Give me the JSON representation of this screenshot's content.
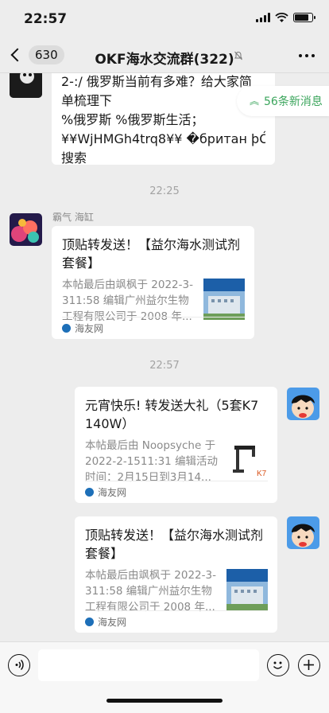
{
  "status_bar": {
    "time": "22:57",
    "battery_level": 0.8
  },
  "nav": {
    "unread_count": "630",
    "title": "OKF海水交流群(322)",
    "muted": true
  },
  "new_messages_pill": {
    "label": "56条新消息"
  },
  "messages": [
    {
      "type": "text",
      "direction": "incoming",
      "lines": [
        "2-:/ 俄罗斯当前有多难？给大家简",
        "单梳理下",
        "%俄罗斯 %俄罗斯生活；",
        "¥¥WjHMGh4trq8¥¥ �британ þÓÜýÏÑ",
        "搜索"
      ]
    },
    {
      "type": "time",
      "text": "22:25"
    },
    {
      "type": "link",
      "direction": "incoming",
      "sender": "霸气 海缸",
      "title": "顶贴转发送！【益尔海水测试剂套餐】",
      "desc": "本帖最后由飒枫于 2022-3-311:58 编辑广州益尔生物工程有限公司于 2008 年...",
      "source": "海友网",
      "thumb_text": "公司首页 益尔人用户手册"
    },
    {
      "type": "time",
      "text": "22:57"
    },
    {
      "type": "link",
      "direction": "outgoing",
      "title": "元宵快乐! 转发送大礼（5套K7 140W）",
      "desc": "本帖最后由 Noopsyche 于 2022-2-1511:31 编辑活动时间：2月15日到3月14...",
      "source": "海友网",
      "thumb_text": "K7"
    },
    {
      "type": "link",
      "direction": "outgoing",
      "title": "顶贴转发送！【益尔海水测试剂套餐】",
      "desc": "本帖最后由飒枫于 2022-3-311:58 编辑广州益尔生物工程有限公司于 2008 年...",
      "source": "海友网",
      "thumb_text": "公司首页 益尔人用户手册"
    }
  ],
  "input_bar": {
    "placeholder": ""
  },
  "colors": {
    "background": "#ededed",
    "bubble": "#ffffff",
    "accent_green": "#3ba55c",
    "source_blue": "#1d6fb8"
  }
}
